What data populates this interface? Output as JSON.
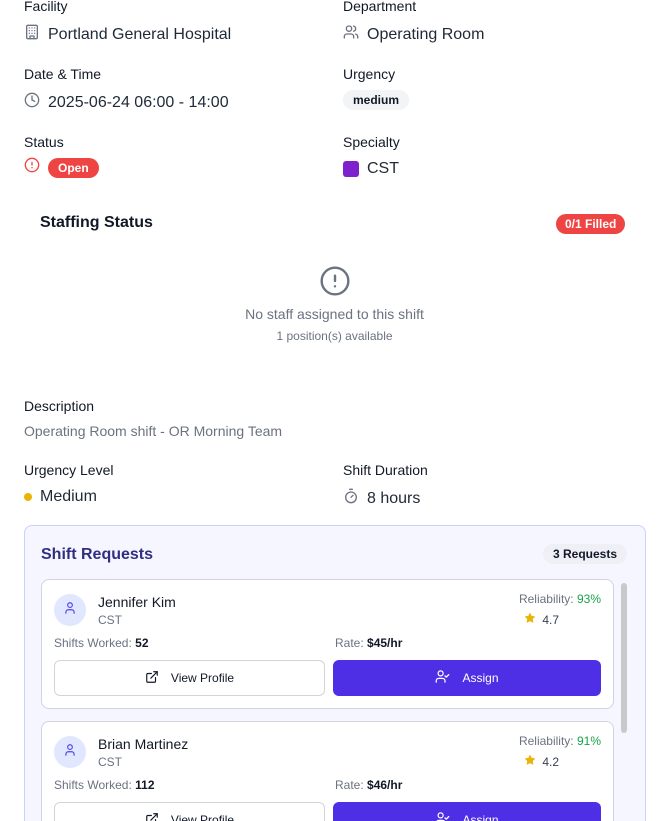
{
  "details": {
    "facility": {
      "label": "Facility",
      "value": "Portland General Hospital",
      "icon": "building-icon"
    },
    "department": {
      "label": "Department",
      "value": "Operating Room",
      "icon": "users-icon"
    },
    "datetime": {
      "label": "Date & Time",
      "value": "2025-06-24 06:00 - 14:00",
      "icon": "clock-icon"
    },
    "urgency": {
      "label": "Urgency",
      "value": "medium"
    },
    "status": {
      "label": "Status",
      "value": "Open",
      "icon": "alert-circle-icon",
      "color": "#ef4444"
    },
    "specialty": {
      "label": "Specialty",
      "value": "CST",
      "color": "#7e22ce"
    }
  },
  "staffing": {
    "title": "Staffing Status",
    "filled_badge": "0/1 Filled",
    "empty_title": "No staff assigned to this shift",
    "empty_sub": "1 position(s) available",
    "icon": "alert-circle-icon"
  },
  "description": {
    "label": "Description",
    "text": "Operating Room shift - OR Morning Team"
  },
  "urgency_level": {
    "label": "Urgency Level",
    "value": "Medium",
    "dot_color": "#eab308"
  },
  "shift_duration": {
    "label": "Shift Duration",
    "value": "8 hours",
    "icon": "timer-icon"
  },
  "requests": {
    "title": "Shift Requests",
    "count": "3 Requests",
    "reliability_label": "Reliability:",
    "shifts_label": "Shifts Worked:",
    "rate_label": "Rate:",
    "view_label": "View Profile",
    "assign_label": "Assign",
    "items": [
      {
        "name": "Jennifer Kim",
        "role": "CST",
        "reliability": "93%",
        "rating": "4.7",
        "shifts": "52",
        "rate": "$45/hr"
      },
      {
        "name": "Brian Martinez",
        "role": "CST",
        "reliability": "91%",
        "rating": "4.2",
        "shifts": "112",
        "rate": "$46/hr"
      }
    ]
  },
  "colors": {
    "primary": "#4f2fe6",
    "danger": "#ef4444",
    "success": "#16a34a",
    "star": "#eab308"
  }
}
